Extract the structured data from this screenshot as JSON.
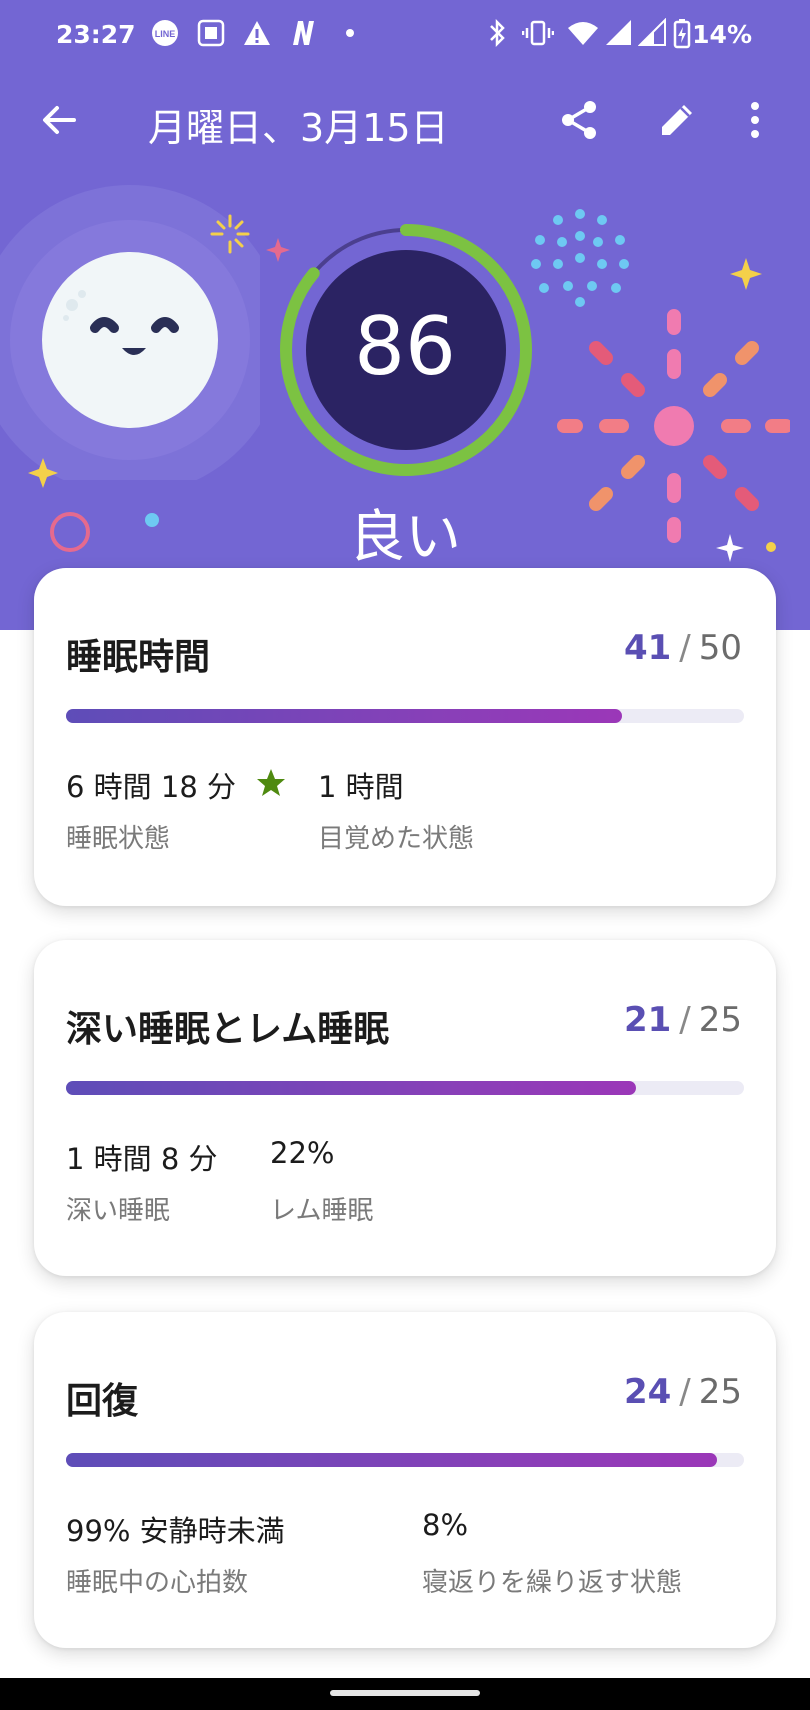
{
  "status_bar": {
    "time": "23:27",
    "battery": "14%",
    "icons": [
      "line-icon",
      "app-icon",
      "warning-icon",
      "n-icon",
      "dot-icon",
      "bluetooth-icon",
      "vibrate-icon",
      "wifi-icon",
      "signal-icon",
      "signal-icon-2",
      "battery-charging-icon"
    ]
  },
  "header": {
    "title": "月曜日、3月15日",
    "actions": [
      "back-icon",
      "share-icon",
      "edit-icon",
      "more-icon"
    ]
  },
  "sleep_score": {
    "value": "86",
    "rating": "良い",
    "fraction": 0.86
  },
  "cards": [
    {
      "title": "睡眠時間",
      "score": "41",
      "max": "50",
      "fraction": 0.82,
      "stats": [
        {
          "value": "6 時間 18 分",
          "label": "睡眠状態",
          "star": true
        },
        {
          "value": "1 時間",
          "label": "目覚めた状態"
        }
      ]
    },
    {
      "title": "深い睡眠とレム睡眠",
      "score": "21",
      "max": "25",
      "fraction": 0.84,
      "stats": [
        {
          "value": "1 時間 8 分",
          "label": "深い睡眠"
        },
        {
          "value": "22%",
          "label": "レム睡眠"
        }
      ]
    },
    {
      "title": "回復",
      "score": "24",
      "max": "25",
      "fraction": 0.96,
      "stats": [
        {
          "value": "99% 安静時未満",
          "label": "睡眠中の心拍数"
        },
        {
          "value": "8%",
          "label": "寝返りを繰り返す状態"
        }
      ]
    }
  ],
  "colors": {
    "header_bg": "#7366d3",
    "accent": "#5a4fb3",
    "ring_green": "#7cc242",
    "score_circle": "#2b2363",
    "star_green": "#4f8a10"
  }
}
